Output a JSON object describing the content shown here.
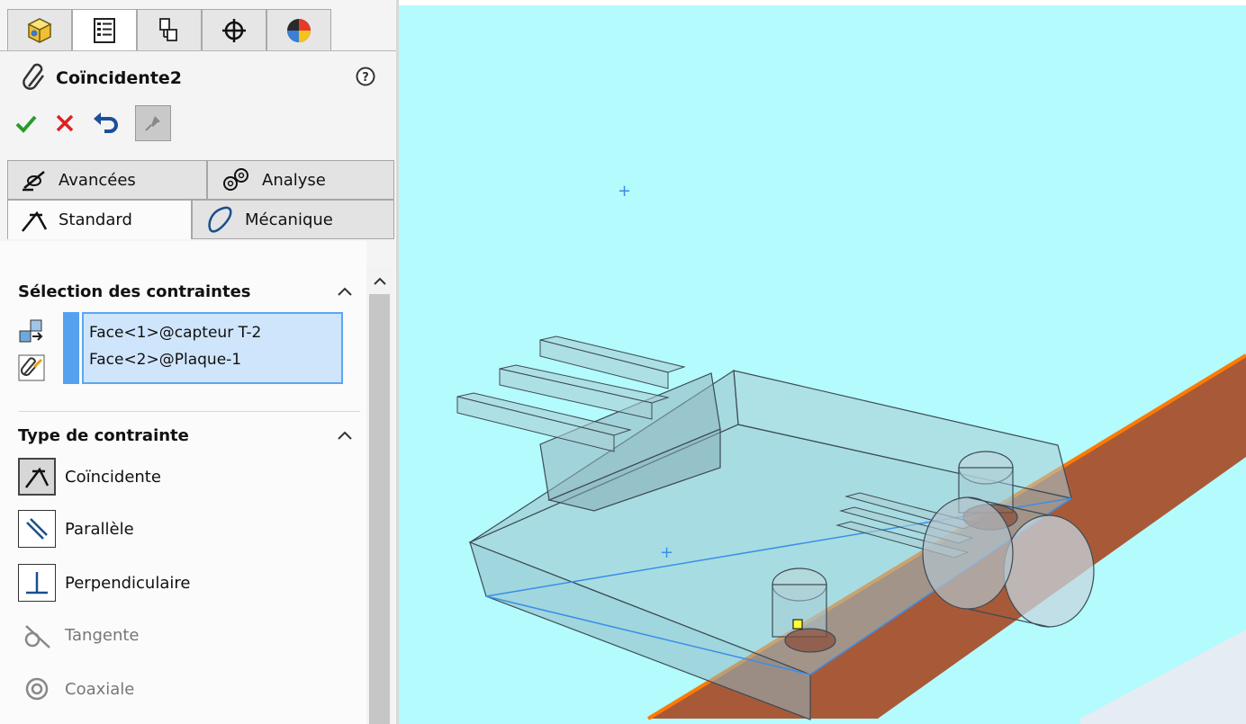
{
  "feature": {
    "title": "Coïncidente2"
  },
  "toolbar": {
    "tabs": [
      "model-icon",
      "property-manager-icon",
      "configuration-icon",
      "dimxpert-icon",
      "display-icon"
    ],
    "confirm_icon": "check-icon",
    "cancel_icon": "x-icon",
    "undo_icon": "undo-icon",
    "pin_icon": "pin-icon"
  },
  "subtabs": {
    "advanced": "Avancées",
    "analysis": "Analyse",
    "standard": "Standard",
    "mechanical": "Mécanique"
  },
  "selection": {
    "heading": "Sélection des contraintes",
    "entities": [
      "Face<1>@capteur T-2",
      "Face<2>@Plaque-1"
    ]
  },
  "mate_type": {
    "heading": "Type de contrainte",
    "options": [
      "Coïncidente",
      "Parallèle",
      "Perpendiculaire",
      "Tangente",
      "Coaxiale"
    ],
    "selected": "Coïncidente"
  },
  "colors": {
    "viewport_bg": "#b3fbfd",
    "selection_blue": "#5aa7f2",
    "plate_brown": "#a85a38",
    "edge_orange": "#ff7a00"
  }
}
